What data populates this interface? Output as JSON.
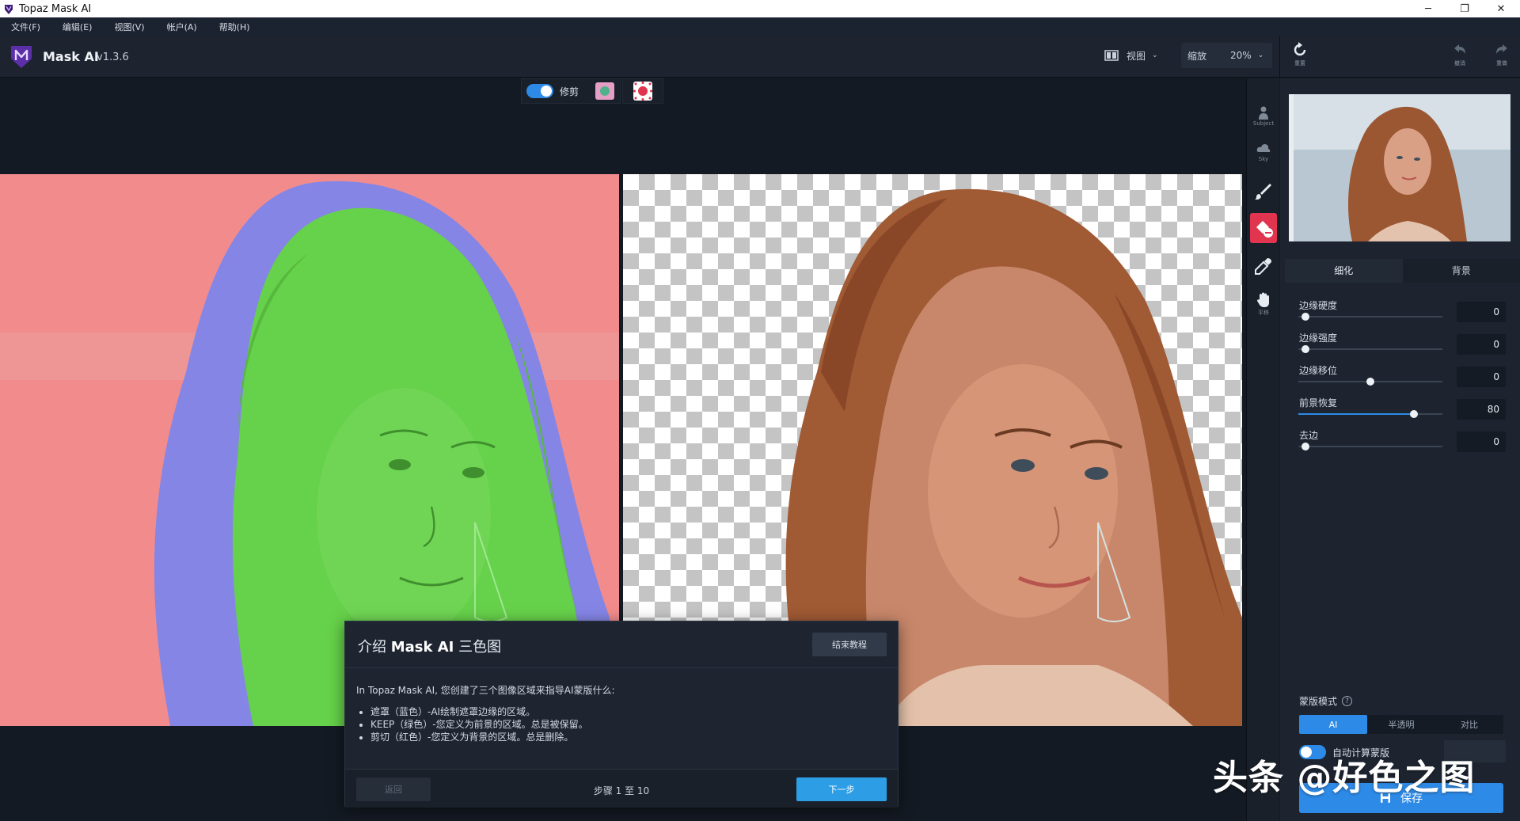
{
  "window": {
    "title": "Topaz Mask AI",
    "minimize": "─",
    "restore": "❐",
    "close": "✕"
  },
  "menu": [
    "文件(F)",
    "编辑(E)",
    "视图(V)",
    "帐户(A)",
    "帮助(H)"
  ],
  "header": {
    "app_name": "Mask AI",
    "version": "v1.3.6",
    "view_label": "视图",
    "zoom_label": "缩放",
    "zoom_value": "20%",
    "reset_label": "重置",
    "undo_label": "撤消",
    "redo_label": "重做"
  },
  "canvas": {
    "cut_toggle_label": "修剪",
    "colors": {
      "cut": "#f28c8c",
      "compute": "#8585e6",
      "keep": "#66d14a",
      "accent": "#2d8ae6",
      "active_tool": "#e0344f"
    }
  },
  "tools": [
    {
      "name": "subject",
      "label": "Subject",
      "icon": "person-icon"
    },
    {
      "name": "sky",
      "label": "Sky",
      "icon": "sky-icon"
    },
    {
      "name": "brush",
      "label": "",
      "icon": "brush-icon"
    },
    {
      "name": "fill",
      "label": "",
      "icon": "fill-bucket-icon",
      "active": true
    },
    {
      "name": "eyedropper",
      "label": "",
      "icon": "eyedropper-icon"
    },
    {
      "name": "pan",
      "label": "平移",
      "icon": "hand-icon"
    }
  ],
  "panel": {
    "tabs": [
      "细化",
      "背景"
    ],
    "sliders": [
      {
        "label": "边缘硬度",
        "value": "0",
        "level": 0.05
      },
      {
        "label": "边缘强度",
        "value": "0",
        "level": 0.05
      },
      {
        "label": "边缘移位",
        "value": "0",
        "level": 0.5
      },
      {
        "label": "前景恢复",
        "value": "80",
        "level": 0.8
      },
      {
        "label": "去边",
        "value": "0",
        "level": 0.05
      }
    ],
    "mask_mode_title": "蒙版模式",
    "mask_modes": [
      "AI",
      "半透明",
      "对比"
    ],
    "auto_compute_label": "自动计算蒙版",
    "save_label": "保存"
  },
  "dialog": {
    "title_prefix": "介绍",
    "title_bold": "Mask AI",
    "title_suffix": "三色图",
    "end_label": "结束教程",
    "intro": "In Topaz Mask AI, 您创建了三个图像区域来指导AI蒙版什么:",
    "items": [
      "遮罩（蓝色）-AI绘制遮罩边缘的区域。",
      "KEEP（绿色）-您定义为前景的区域。总是被保留。",
      "剪切（红色）-您定义为背景的区域。总是删除。"
    ],
    "back_label": "返回",
    "step_text": "步骤 1 至 10",
    "next_label": "下一步"
  },
  "watermark": "头条 @好色之图"
}
